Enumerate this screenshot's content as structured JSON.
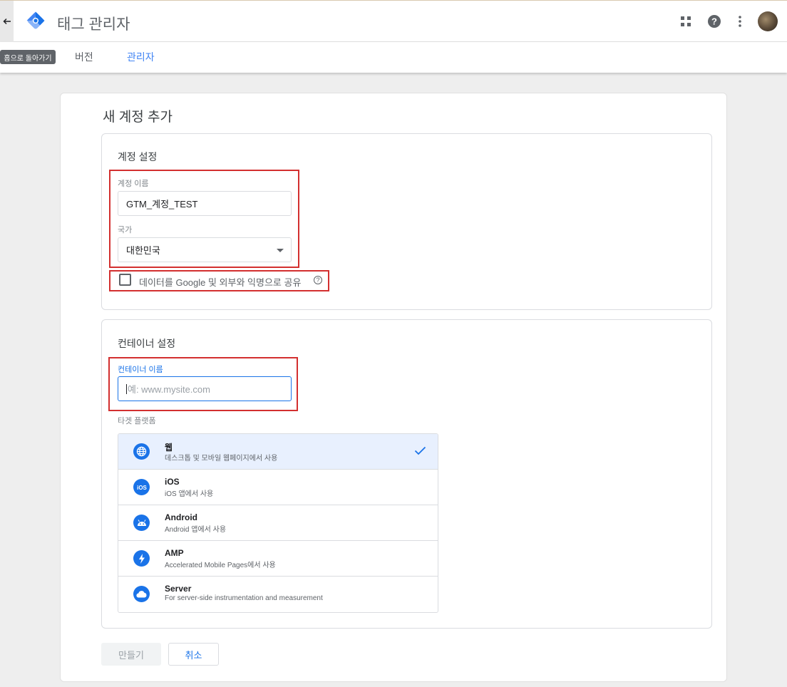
{
  "app": {
    "title": "태그 관리자"
  },
  "tooltip": "홈으로 돌아가기",
  "nav": {
    "versions": "버전",
    "admin": "관리자"
  },
  "top_icons": [
    "apps-grid-icon",
    "help-icon",
    "more-vert-icon",
    "avatar"
  ],
  "page": {
    "title": "새 계정 추가"
  },
  "account_settings": {
    "title": "계정 설정",
    "account_name_label": "계정 이름",
    "account_name_value": "GTM_계정_TEST",
    "country_label": "국가",
    "country_value": "대한민국",
    "share_data_label": "데이터를 Google 및 외부와 익명으로 공유",
    "share_data_checked": false
  },
  "container_settings": {
    "title": "컨테이너 설정",
    "container_name_label": "컨테이너 이름",
    "container_name_placeholder": "예: www.mysite.com",
    "target_platform_label": "타겟 플랫폼",
    "platforms": [
      {
        "name": "웹",
        "desc": "데스크톱 및 모바일 웹페이지에서 사용",
        "icon": "globe-icon",
        "selected": true
      },
      {
        "name": "iOS",
        "desc": "iOS 앱에서 사용",
        "icon": "ios-icon",
        "selected": false
      },
      {
        "name": "Android",
        "desc": "Android 앱에서 사용",
        "icon": "android-icon",
        "selected": false
      },
      {
        "name": "AMP",
        "desc": "Accelerated Mobile Pages에서 사용",
        "icon": "amp-bolt-icon",
        "selected": false
      },
      {
        "name": "Server",
        "desc": "For server-side instrumentation and measurement",
        "icon": "cloud-icon",
        "selected": false
      }
    ]
  },
  "buttons": {
    "create": "만들기",
    "cancel": "취소"
  },
  "colors": {
    "accent": "#1a73e8",
    "highlight": "#d32f2f",
    "selected_row": "#e8f0fe"
  }
}
